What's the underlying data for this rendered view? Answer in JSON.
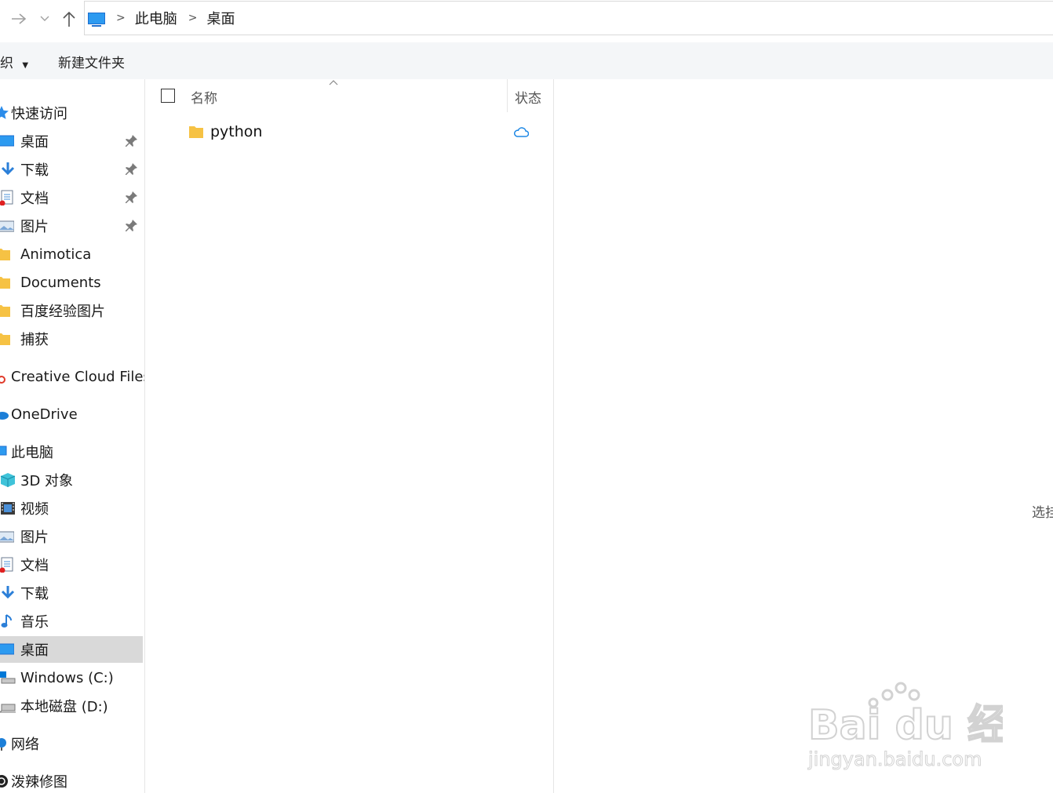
{
  "breadcrumb": {
    "items": [
      "此电脑",
      "桌面"
    ]
  },
  "ribbon": {
    "organize_label": "织",
    "new_folder_label": "新建文件夹"
  },
  "nav": {
    "quick_access": "快速访问",
    "quick_items": [
      "桌面",
      "下载",
      "文档",
      "图片",
      "Animotica",
      "Documents",
      "百度经验图片",
      "捕获"
    ],
    "creative_cloud": "Creative Cloud Files",
    "onedrive": "OneDrive",
    "this_pc": "此电脑",
    "pc_items": [
      "3D 对象",
      "视频",
      "图片",
      "文档",
      "下载",
      "音乐",
      "桌面",
      "Windows (C:)",
      "本地磁盘 (D:)"
    ],
    "network": "网络",
    "app": "泼辣修图"
  },
  "columns": {
    "name": "名称",
    "status": "状态"
  },
  "files": [
    {
      "name": "python",
      "status_icon": "cloud-icon"
    }
  ],
  "details_hint": "选挂",
  "watermark": {
    "brand": "Bai du 经验",
    "url": "jingyan.baidu.com"
  },
  "colors": {
    "accent": "#1e88e5",
    "selection": "#d9d9d9",
    "folder": "#f6c244"
  }
}
